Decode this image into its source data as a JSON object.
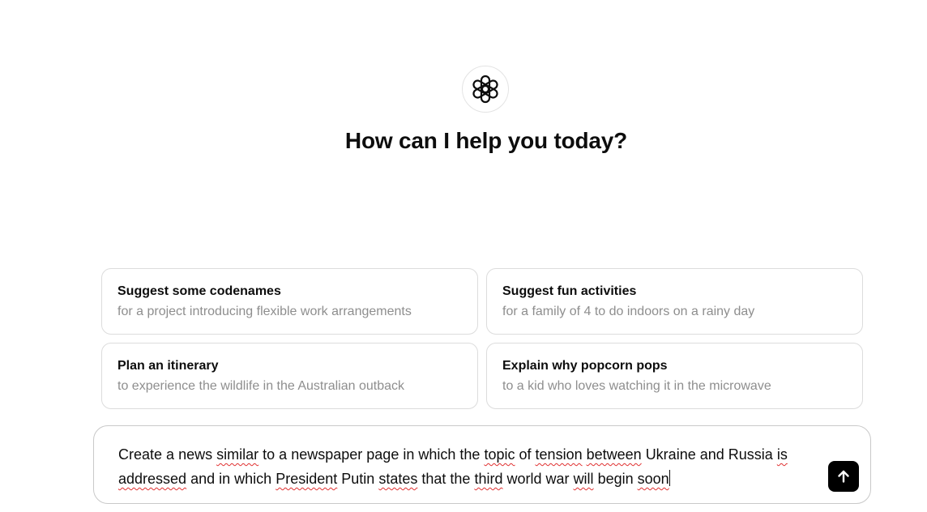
{
  "header": {
    "title": "How can I help you today?",
    "logo_icon": "openai-logo-icon"
  },
  "suggestions": [
    {
      "title": "Suggest some codenames",
      "subtitle": "for a project introducing flexible work arrangements"
    },
    {
      "title": "Suggest fun activities",
      "subtitle": "for a family of 4 to do indoors on a rainy day"
    },
    {
      "title": "Plan an itinerary",
      "subtitle": "to experience the wildlife in the Australian outback"
    },
    {
      "title": "Explain why popcorn pops",
      "subtitle": "to a kid who loves watching it in the microwave"
    }
  ],
  "composer": {
    "value": "Create a news similar to a newspaper page in which the topic of tension between Ukraine and Russia is addressed and in which President Putin states that the third world war will begin soon",
    "misspelled_words": [
      "similar",
      "topic",
      "tension",
      "between",
      "is",
      "addressed",
      "President",
      "states",
      "third",
      "will",
      "soon"
    ],
    "send_icon": "arrow-up-icon"
  },
  "colors": {
    "send_button_bg": "#000000",
    "card_border": "#dcdcdc",
    "subtitle_text": "#8e8e8e",
    "spellcheck_underline": "#e03030"
  }
}
